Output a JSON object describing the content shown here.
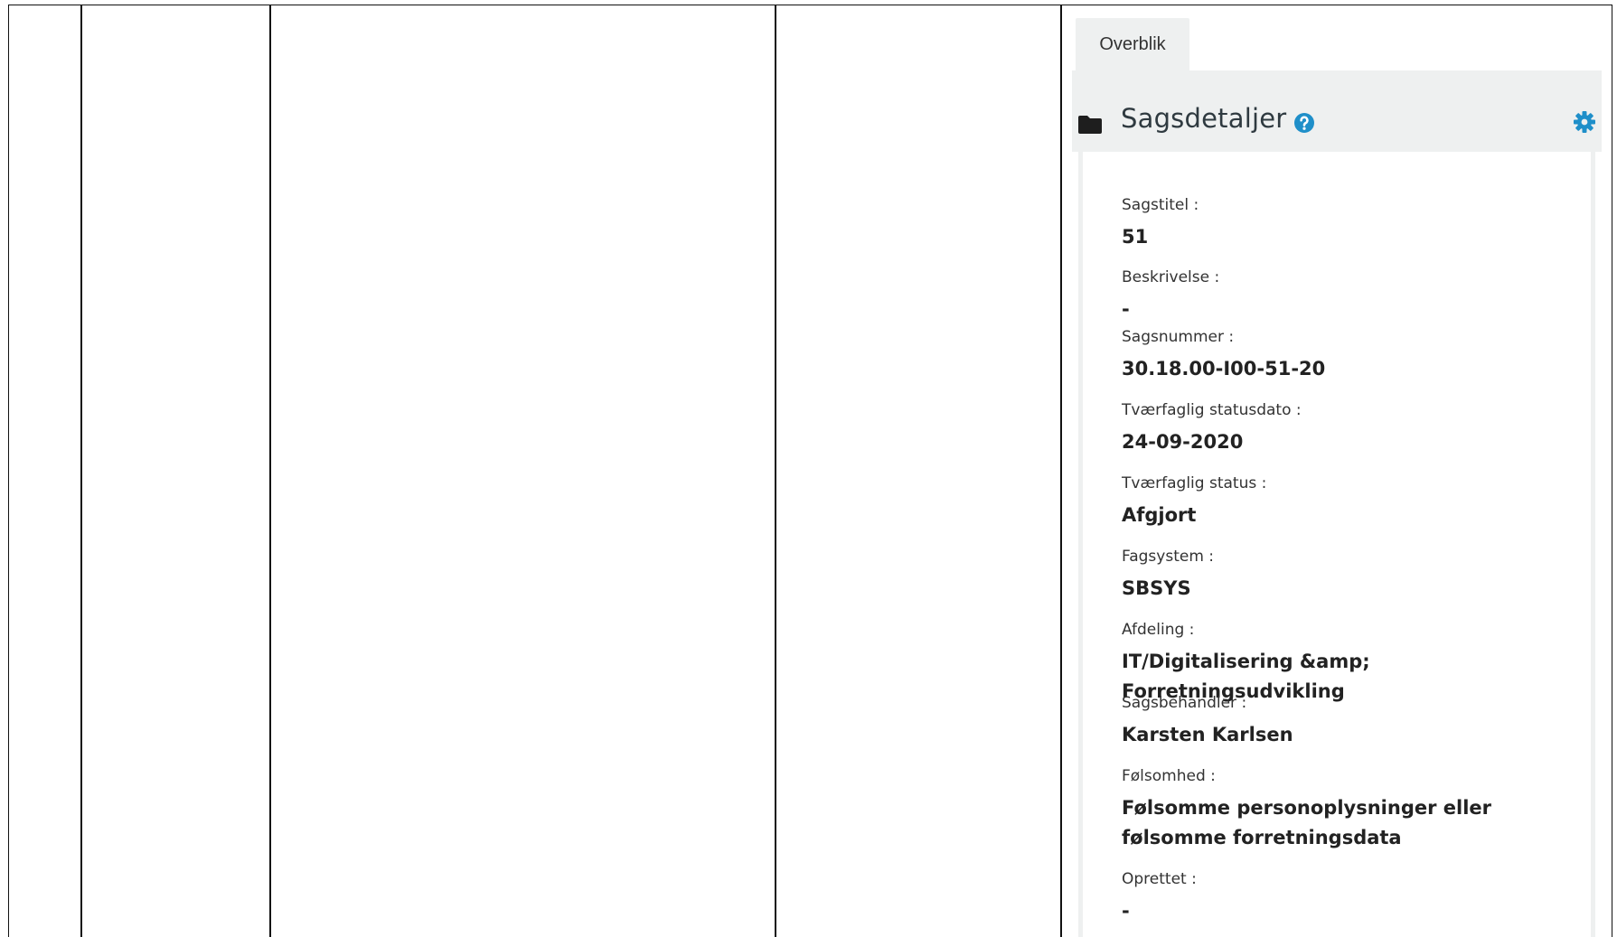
{
  "tabs": [
    {
      "label": "Overblik"
    }
  ],
  "card": {
    "title": "Sagsdetaljer",
    "icons": {
      "header": "folder-icon",
      "help": "question-circle-icon",
      "settings": "gear-icon"
    },
    "accent_color": "#1f8fc9"
  },
  "fields": [
    {
      "label": "Sagstitel :",
      "value": "51"
    },
    {
      "label": "Beskrivelse :",
      "value": "-"
    },
    {
      "label": "Sagsnummer :",
      "value": "30.18.00-I00-51-20"
    },
    {
      "label": "Tværfaglig statusdato :",
      "value": "24-09-2020"
    },
    {
      "label": "Tværfaglig status :",
      "value": "Afgjort"
    },
    {
      "label": "Fagsystem :",
      "value": "SBSYS"
    },
    {
      "label": "Afdeling :",
      "value": "IT/Digitalisering &amp; Forretningsudvikling"
    },
    {
      "label": "Sagsbehandler :",
      "value": "Karsten Karlsen"
    },
    {
      "label": "Følsomhed :",
      "value": "Følsomme personoplysninger eller følsomme forretningsdata"
    },
    {
      "label": "Oprettet :",
      "value": "-"
    }
  ]
}
